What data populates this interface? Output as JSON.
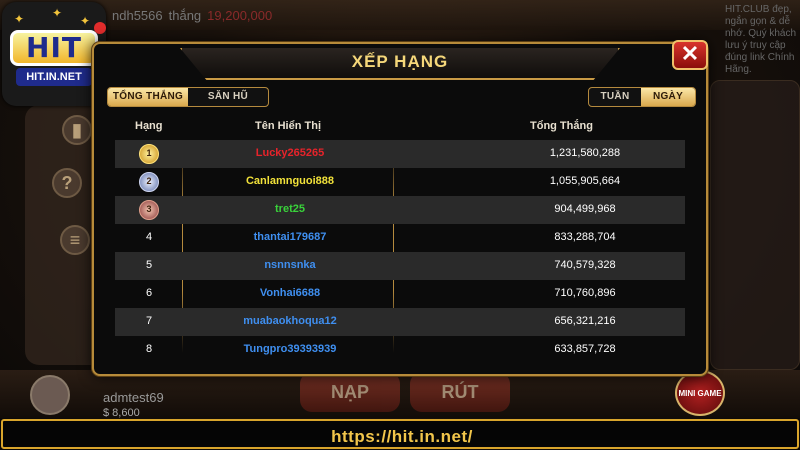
{
  "background": {
    "ticker": {
      "user": "ndh5566",
      "word": "thắng",
      "amount": "19,200,000"
    },
    "notice": "HIT.CLUB đẹp, ngắn gọn & dễ nhớ. Quý khách lưu ý truy cập đúng link Chính Hãng.",
    "bottom": {
      "deposit_label": "NẠP",
      "withdraw_label": "RÚT",
      "username": "admtest69",
      "balance": "$ 8,600",
      "minigame_label": "MINI GAME"
    }
  },
  "logo": {
    "word": "HIT",
    "domain": "HIT.IN.NET"
  },
  "dialog": {
    "title": "XẾP HẠNG",
    "close_icon": "close-x-icon",
    "category_tabs": [
      {
        "label": "TỔNG THẮNG",
        "active": true
      },
      {
        "label": "SĂN HŨ",
        "active": false
      }
    ],
    "period_tabs": [
      {
        "label": "TUẦN",
        "active": false
      },
      {
        "label": "NGÀY",
        "active": true
      }
    ],
    "columns": {
      "rank": "Hạng",
      "name": "Tên Hiển Thị",
      "total": "Tổng Thắng"
    },
    "rows": [
      {
        "rank": "1",
        "medal": "gold-medal-icon",
        "name": "Lucky265265",
        "total": "1,231,580,288",
        "name_color": "#e8232a"
      },
      {
        "rank": "2",
        "medal": "silver-medal-icon",
        "name": "Canlamnguoi888",
        "total": "1,055,905,664",
        "name_color": "#f2e23a"
      },
      {
        "rank": "3",
        "medal": "bronze-medal-icon",
        "name": "tret25",
        "total": "904,499,968",
        "name_color": "#39d23a"
      },
      {
        "rank": "4",
        "name": "thantai179687",
        "total": "833,288,704",
        "name_color": "#3f8ff0"
      },
      {
        "rank": "5",
        "name": "nsnnsnka",
        "total": "740,579,328",
        "name_color": "#3f8ff0"
      },
      {
        "rank": "6",
        "name": "Vonhai6688",
        "total": "710,760,896",
        "name_color": "#3f8ff0"
      },
      {
        "rank": "7",
        "name": "muabaokhoqua12",
        "total": "656,321,216",
        "name_color": "#3f8ff0"
      },
      {
        "rank": "8",
        "name": "Tungpro39393939",
        "total": "633,857,728",
        "name_color": "#3f8ff0"
      }
    ]
  },
  "url_bar": {
    "url": "https://hit.in.net/"
  }
}
